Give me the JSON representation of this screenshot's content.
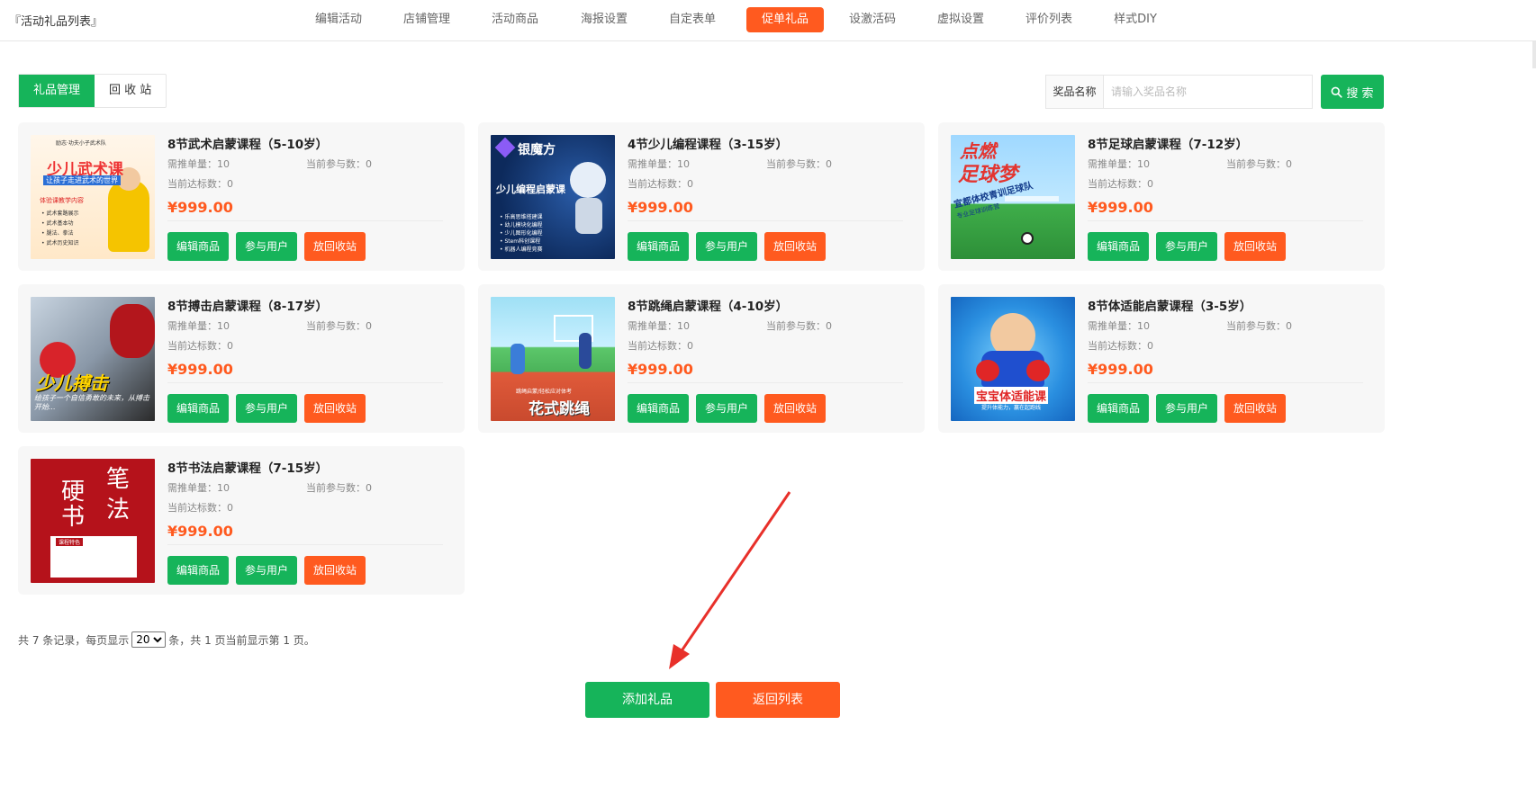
{
  "page_title": "『活动礼品列表』",
  "nav": [
    {
      "label": "编辑活动",
      "active": false
    },
    {
      "label": "店铺管理",
      "active": false
    },
    {
      "label": "活动商品",
      "active": false
    },
    {
      "label": "海报设置",
      "active": false
    },
    {
      "label": "自定表单",
      "active": false
    },
    {
      "label": "促单礼品",
      "active": true
    },
    {
      "label": "设激活码",
      "active": false
    },
    {
      "label": "虚拟设置",
      "active": false
    },
    {
      "label": "评价列表",
      "active": false
    },
    {
      "label": "样式DIY",
      "active": false
    }
  ],
  "tabs": [
    {
      "label": "礼品管理",
      "active": true
    },
    {
      "label": "回 收 站",
      "active": false
    }
  ],
  "search": {
    "label": "奖品名称",
    "placeholder": "请输入奖品名称",
    "value": "",
    "button_label": "搜 索"
  },
  "card_labels": {
    "required_orders": "需推单量：",
    "current_participants": "当前参与数：",
    "current_reached": "当前达标数：",
    "currency": "¥",
    "edit_button": "编辑商品",
    "users_button": "参与用户",
    "recycle_button": "放回收站"
  },
  "gifts": [
    {
      "name": "8节武术启蒙课程（5-10岁）",
      "required_orders": "10",
      "current_participants": "0",
      "current_reached": "0",
      "price": "999.00",
      "thumb_style": "wushu",
      "thumb_text": [
        "励志·功夫小子武术队",
        "少儿武术课",
        "让孩子走进武术的世界",
        "体验课教学内容",
        "• 武术套路展示",
        "• 武术基本功",
        "• 腿法、拳法",
        "• 武术历史知识"
      ]
    },
    {
      "name": "4节少儿编程课程（3-15岁）",
      "required_orders": "10",
      "current_participants": "0",
      "current_reached": "0",
      "price": "999.00",
      "thumb_style": "coding",
      "thumb_text": [
        "银魔方",
        "少儿编程启蒙课",
        "• 乐高思维搭建课",
        "• 幼儿模块化编程",
        "• 少儿图形化编程",
        "• Stem科创课程",
        "• 机器人编程竞赛"
      ]
    },
    {
      "name": "8节足球启蒙课程（7-12岁）",
      "required_orders": "10",
      "current_participants": "0",
      "current_reached": "0",
      "price": "999.00",
      "thumb_style": "football",
      "thumb_text": [
        "点燃",
        "足球梦",
        "宜都体校青训足球队",
        "专业足球训练营"
      ]
    },
    {
      "name": "8节搏击启蒙课程（8-17岁）",
      "required_orders": "10",
      "current_participants": "0",
      "current_reached": "0",
      "price": "999.00",
      "thumb_style": "boxing",
      "thumb_text": [
        "少儿搏击",
        "给孩子一个自信勇敢的未来，从搏击开始..."
      ]
    },
    {
      "name": "8节跳绳启蒙课程（4-10岁）",
      "required_orders": "10",
      "current_participants": "0",
      "current_reached": "0",
      "price": "999.00",
      "thumb_style": "rope",
      "thumb_text": [
        "跳绳启蒙/轻松应对体考",
        "花式跳绳"
      ]
    },
    {
      "name": "8节体适能启蒙课程（3-5岁）",
      "required_orders": "10",
      "current_participants": "0",
      "current_reached": "0",
      "price": "999.00",
      "thumb_style": "fitness",
      "thumb_text": [
        "宝宝体适能课",
        "提升体能力，赢在起跑线"
      ]
    },
    {
      "name": "8节书法启蒙课程（7-15岁）",
      "required_orders": "10",
      "current_participants": "0",
      "current_reached": "0",
      "price": "999.00",
      "thumb_style": "calli",
      "thumb_text": [
        "硬",
        "笔",
        "书",
        "法",
        "课程特色"
      ]
    }
  ],
  "pagination": {
    "prefix": "共 7 条记录，每页显示",
    "page_size": "20",
    "page_size_options": [
      "20"
    ],
    "suffix": "条，共 1 页当前显示第 1 页。"
  },
  "bottom_buttons": {
    "add": "添加礼品",
    "back": "返回列表"
  },
  "colors": {
    "green": "#16b45a",
    "orange": "#ff5a1f",
    "arrow": "#e8302a"
  }
}
